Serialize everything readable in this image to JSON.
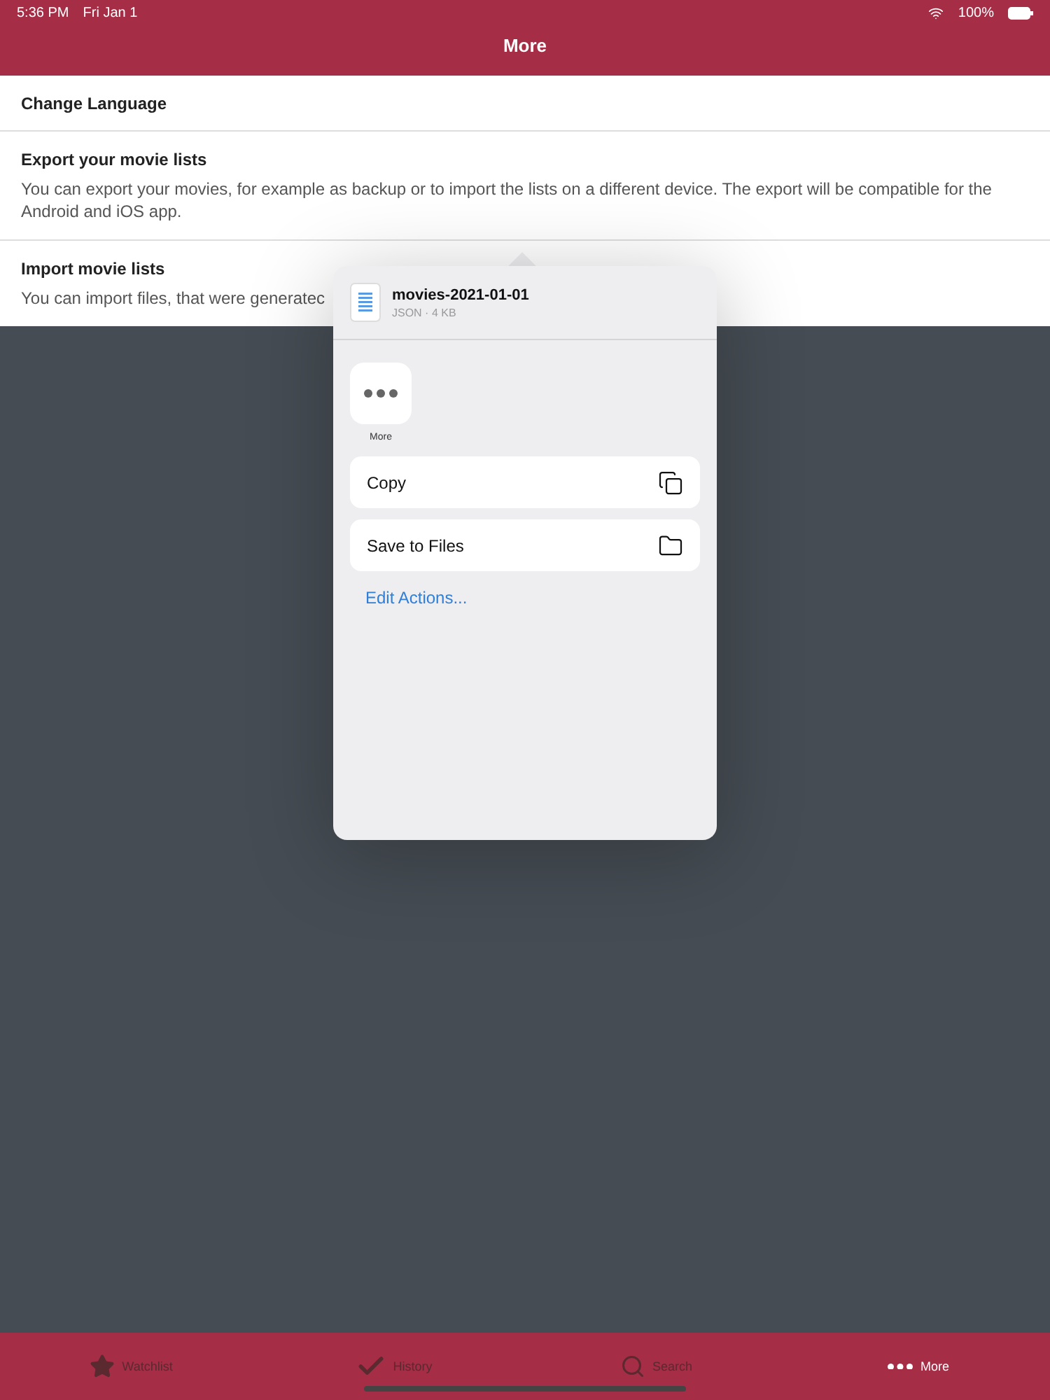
{
  "status_bar": {
    "time": "5:36 PM",
    "date": "Fri Jan 1",
    "battery": "100%"
  },
  "nav": {
    "title": "More"
  },
  "settings": [
    {
      "title": "Change Language"
    },
    {
      "title": "Export your movie lists",
      "description": "You can export your movies, for example as backup or to import the lists on a different device. The export will be compatible for the Android and iOS app."
    },
    {
      "title": "Import movie lists",
      "description": "You can import files, that were generatec"
    }
  ],
  "share_sheet": {
    "file_name": "movies-2021-01-01",
    "file_meta": "JSON · 4 KB",
    "apps": [
      {
        "label": "More"
      }
    ],
    "actions": [
      {
        "label": "Copy",
        "kind": "copy"
      },
      {
        "label": "Save to Files",
        "kind": "folder"
      }
    ],
    "edit_actions": "Edit Actions..."
  },
  "tabs": [
    {
      "label": "Watchlist",
      "kind": "star",
      "selected": false
    },
    {
      "label": "History",
      "kind": "check",
      "selected": false
    },
    {
      "label": "Search",
      "kind": "search",
      "selected": false
    },
    {
      "label": "More",
      "kind": "dots",
      "selected": true
    }
  ]
}
